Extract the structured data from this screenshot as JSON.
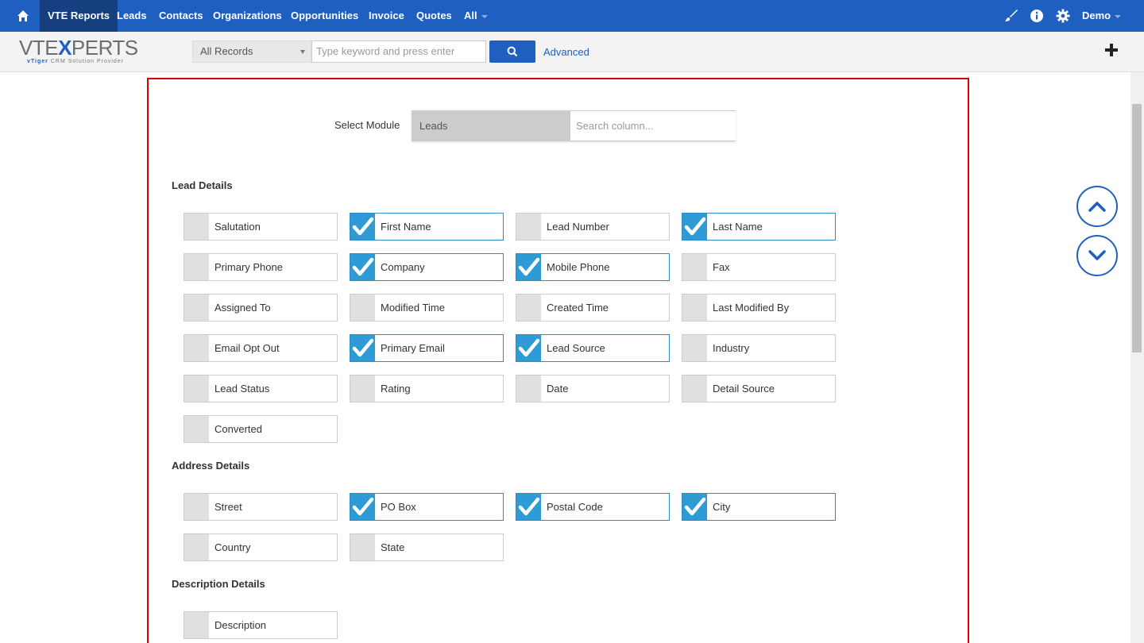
{
  "nav": {
    "items": [
      {
        "label": "VTE Reports",
        "active": true
      },
      {
        "label": "Leads"
      },
      {
        "label": "Contacts"
      },
      {
        "label": "Organizations"
      },
      {
        "label": "Opportunities"
      },
      {
        "label": "Invoice"
      },
      {
        "label": "Quotes"
      },
      {
        "label": "All"
      }
    ],
    "user": "Demo",
    "icons": [
      "home-icon",
      "brush-icon",
      "info-icon",
      "gear-icon"
    ]
  },
  "logo": {
    "main_a": "VTE",
    "main_x": "X",
    "main_b": "PERTS",
    "sub_brand": "vTiger",
    "sub_text": "CRM Solution Provider"
  },
  "search": {
    "records_value": "All Records",
    "placeholder": "Type keyword and press enter",
    "advanced_label": "Advanced"
  },
  "module_select": {
    "label": "Select Module",
    "value": "Leads",
    "column_search_placeholder": "Search column..."
  },
  "sections": [
    {
      "title": "Lead Details",
      "fields": [
        {
          "label": "Salutation",
          "checked": false
        },
        {
          "label": "First Name",
          "checked": true
        },
        {
          "label": "Lead Number",
          "checked": false
        },
        {
          "label": "Last Name",
          "checked": true
        },
        {
          "label": "Primary Phone",
          "checked": false
        },
        {
          "label": "Company",
          "checked": true
        },
        {
          "label": "Mobile Phone",
          "checked": true
        },
        {
          "label": "Fax",
          "checked": false
        },
        {
          "label": "Assigned To",
          "checked": false
        },
        {
          "label": "Modified Time",
          "checked": false
        },
        {
          "label": "Created Time",
          "checked": false
        },
        {
          "label": "Last Modified By",
          "checked": false
        },
        {
          "label": "Email Opt Out",
          "checked": false
        },
        {
          "label": "Primary Email",
          "checked": true
        },
        {
          "label": "Lead Source",
          "checked": true
        },
        {
          "label": "Industry",
          "checked": false
        },
        {
          "label": "Lead Status",
          "checked": false
        },
        {
          "label": "Rating",
          "checked": false
        },
        {
          "label": "Date",
          "checked": false
        },
        {
          "label": "Detail Source",
          "checked": false
        },
        {
          "label": "Converted",
          "checked": false
        }
      ]
    },
    {
      "title": "Address Details",
      "fields": [
        {
          "label": "Street",
          "checked": false
        },
        {
          "label": "PO Box",
          "checked": true
        },
        {
          "label": "Postal Code",
          "checked": true
        },
        {
          "label": "City",
          "checked": true
        },
        {
          "label": "Country",
          "checked": false
        },
        {
          "label": "State",
          "checked": false
        }
      ]
    },
    {
      "title": "Description Details",
      "fields": [
        {
          "label": "Description",
          "checked": false
        }
      ]
    }
  ],
  "colors": {
    "nav": "#1f5fbf",
    "checked": "#2e9ad6",
    "highlight_border": "#e00000"
  }
}
